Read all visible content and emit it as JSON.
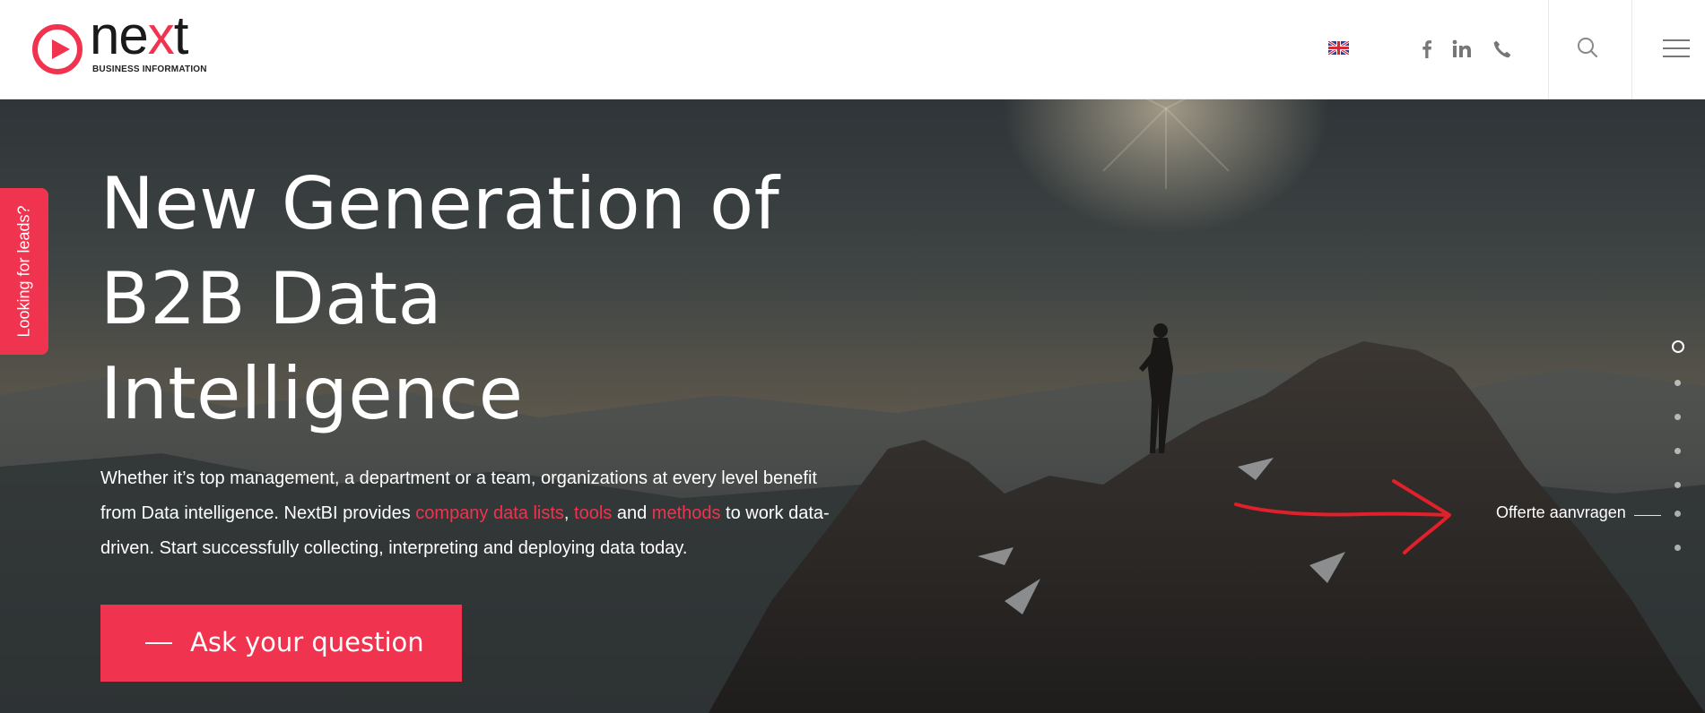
{
  "header": {
    "logo": {
      "word_start": "ne",
      "word_x": "x",
      "word_end": "t",
      "tagline": "BUSINESS INFORMATION"
    },
    "language": "English",
    "social": [
      "facebook-icon",
      "linkedin-icon",
      "phone-icon"
    ],
    "search_icon": "search-icon",
    "menu_icon": "hamburger-menu-icon"
  },
  "hero": {
    "title_lines": [
      "New Generation of",
      "B2B Data",
      "Intelligence"
    ],
    "text_part1": "Whether it’s top management, a department or a team, organizations at every level benefit from Data intelligence. NextBI provides ",
    "link1": "company data lists",
    "sep1": ", ",
    "link2": "tools",
    "sep2": " and ",
    "link3": "methods",
    "text_part2": " to work data-driven. Start successfully collecting, interpreting and deploying data today.",
    "cta_label": "Ask your question"
  },
  "side_tab": {
    "label": "Looking for leads?"
  },
  "dot_nav": {
    "count": 7,
    "active_index": 0,
    "hover_label": "Offerte aanvragen"
  },
  "colors": {
    "accent": "#f0334e",
    "header_bg": "#ffffff",
    "icon_grey": "#777777",
    "annotation": "#e0202a"
  }
}
